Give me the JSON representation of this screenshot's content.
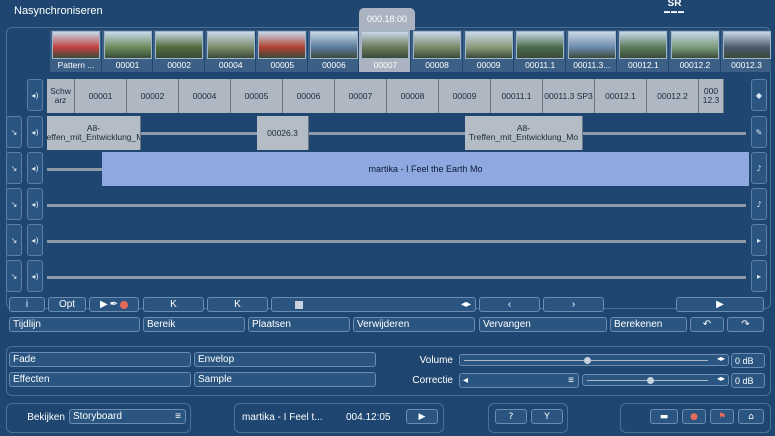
{
  "window": {
    "title": "Nasynchroniseren",
    "logo": "SR",
    "timecode": "000.18:00"
  },
  "thumbnails": [
    {
      "label": "Pattern ...",
      "color": "#c04040"
    },
    {
      "label": "00001",
      "color": "#6b8a5a"
    },
    {
      "label": "00002",
      "color": "#4f6a3a"
    },
    {
      "label": "00004",
      "color": "#7a8c6a"
    },
    {
      "label": "00005",
      "color": "#b04030"
    },
    {
      "label": "00006",
      "color": "#5a7a9a"
    },
    {
      "label": "00007",
      "color": "#6a7a5a"
    },
    {
      "label": "00008",
      "color": "#7a8a6a"
    },
    {
      "label": "00009",
      "color": "#8a9a7a"
    },
    {
      "label": "00011.1",
      "color": "#4a6a4a"
    },
    {
      "label": "00011.3...",
      "color": "#6a8aaa"
    },
    {
      "label": "00012.1",
      "color": "#5a7a5a"
    },
    {
      "label": "00012.2",
      "color": "#7a9a7a"
    },
    {
      "label": "00012.3",
      "color": "#4a5a6a"
    }
  ],
  "video_track": [
    "Schw arz",
    "00001",
    "00002",
    "00004",
    "00005",
    "00006",
    "00007",
    "00008",
    "00009",
    "00011.1",
    "00011.3 SP3",
    "00012.1",
    "00012.2",
    "000 12.3"
  ],
  "audio_track_1": [
    "A8-Treffen_mit_Entwicklung_Mo",
    "00026.3",
    "A8-Treffen_mit_Entwicklung_Mo"
  ],
  "audio_track_2": "martika - I Feel the Earth Mo",
  "toolbar": {
    "info": "i",
    "opt": "Opt"
  },
  "actions": {
    "timeline": "Tijdlijn",
    "range": "Bereik",
    "place": "Plaatsen",
    "remove": "Verwijderen",
    "replace": "Vervangen",
    "calculate": "Berekenen"
  },
  "bottom": {
    "fade": "Fade",
    "envelope": "Envelop",
    "effects": "Effecten",
    "sample": "Sample",
    "volume_label": "Volume",
    "correction_label": "Correctie",
    "volume_value": "0 dB",
    "correction_value": "0 dB",
    "volume_level": 0.5,
    "correction_level": 0.5
  },
  "footer": {
    "view_label": "Bekijken",
    "view_mode": "Storyboard",
    "clip_name": "martika - I Feel t...",
    "clip_time": "004.12:05"
  }
}
